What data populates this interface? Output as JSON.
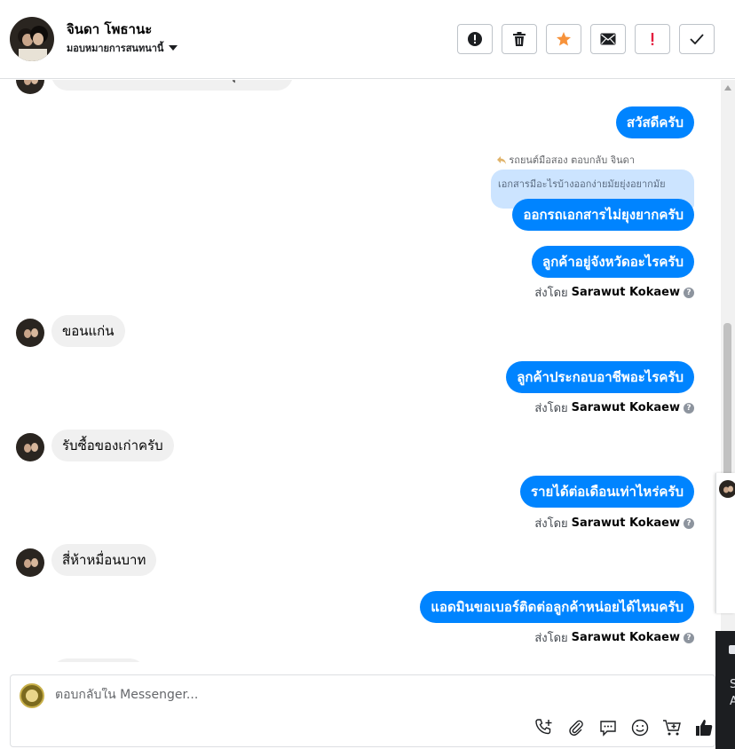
{
  "header": {
    "contact_name": "จินดา โพธานะ",
    "assign_label": "มอบหมายการสนทนานี้"
  },
  "messages": {
    "top_partial": "เอกสารมีอะไรบ้างออกง่ายมัยยุ่งยากมัย",
    "m1": "สวัสดีครับ",
    "reply_meta": "รถยนต์มือสอง ตอบกลับ จินดา",
    "quoted": "เอกสารมีอะไรบ้างออกง่ายมัยยุ่งอยากมัย",
    "m2": "ออกรถเอกสารไม่ยุงยากครับ",
    "m3": "ลูกค้าอยู่จังหวัดอะไรครับ",
    "sent_by_prefix": "ส่งโดย",
    "sender": "Sarawut Kokaew",
    "in1": "ขอนแก่น",
    "m4": "ลูกค้าประกอบอาชีพอะไรครับ",
    "in2": "รับซื้อของเก่าครับ",
    "m5": "รายได้ต่อเดือนเท่าไหร่ครับ",
    "in3": "สี่ห้าหมื่อนบาท",
    "m6": "แอดมินขอเบอร์ติดต่อลูกค้าหน่อยได้ไหมครับ"
  },
  "composer": {
    "placeholder": "ตอบกลับใน Messenger..."
  },
  "side_panel": {
    "line1": "S",
    "line2": "A"
  },
  "colors": {
    "accent": "#0084ff",
    "incoming_bubble": "#f0f0f0",
    "star": "#f7923a",
    "alert": "#e41e3f"
  }
}
